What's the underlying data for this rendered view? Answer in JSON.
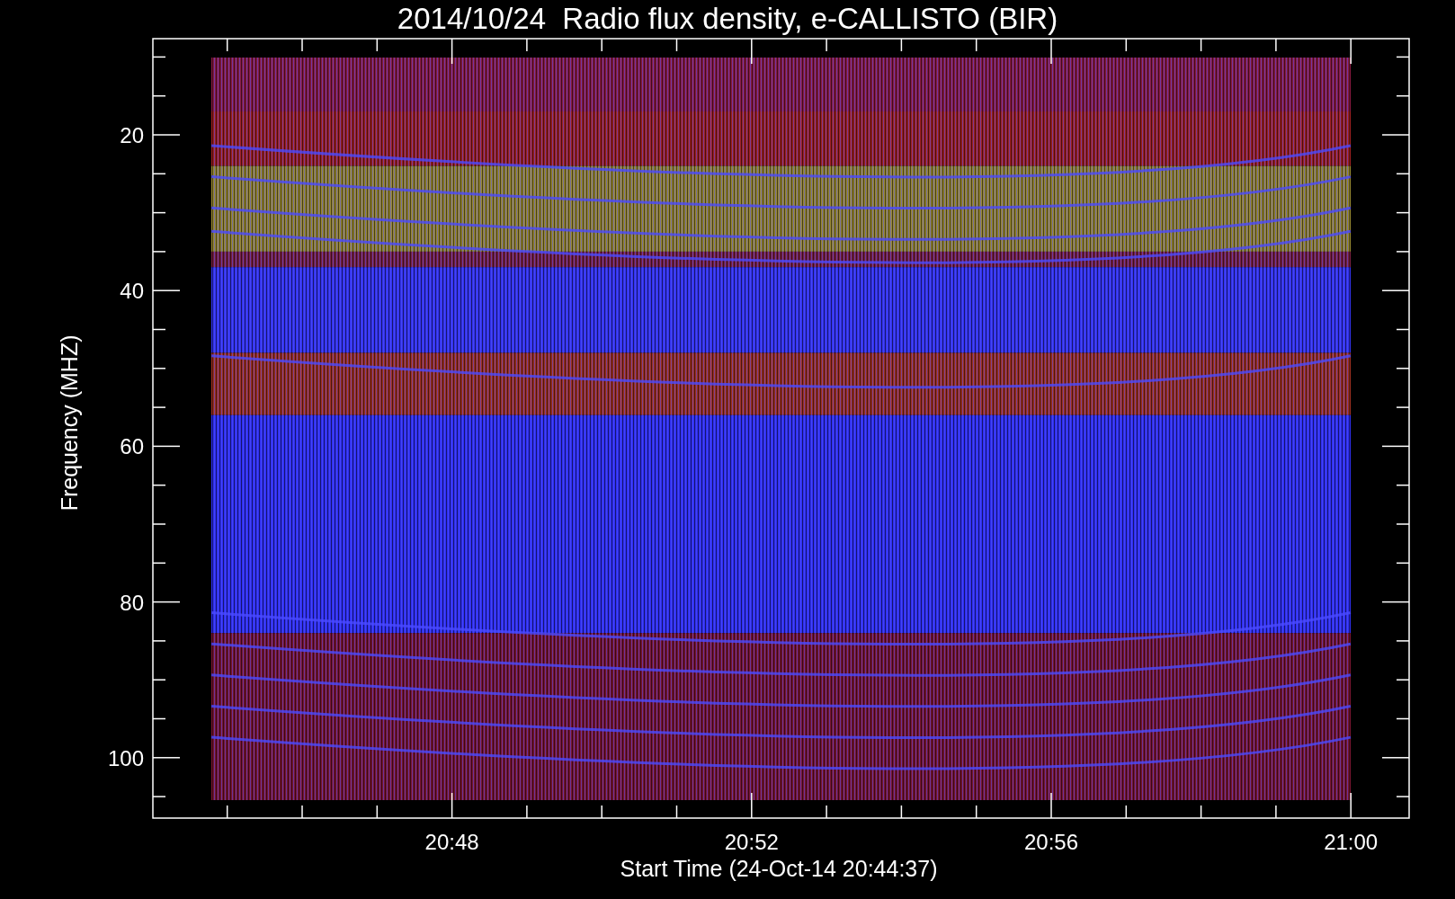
{
  "title": "2014/10/24  Radio flux density, e-CALLISTO (BIR)",
  "y_axis": {
    "label": "Frequency (MHZ)",
    "ticks": [
      "20",
      "40",
      "60",
      "80",
      "100"
    ]
  },
  "x_axis": {
    "label": "Start Time (24-Oct-14 20:44:37)",
    "ticks": [
      "20:48",
      "20:52",
      "20:56",
      "21:00"
    ]
  }
}
